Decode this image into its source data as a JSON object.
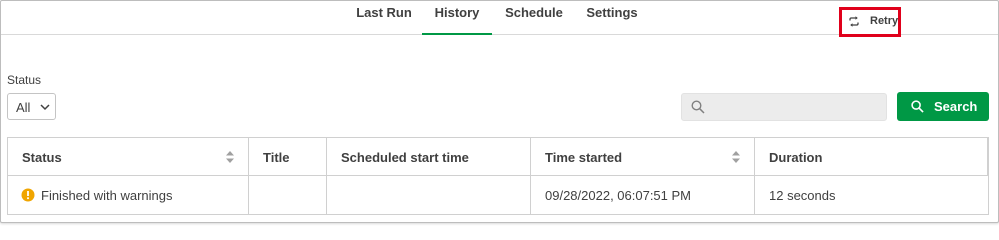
{
  "tabs": [
    {
      "label": "Last Run",
      "active": false
    },
    {
      "label": "History",
      "active": true
    },
    {
      "label": "Schedule",
      "active": false
    },
    {
      "label": "Settings",
      "active": false
    }
  ],
  "filter": {
    "status_label": "Status",
    "status_value": "All"
  },
  "search": {
    "placeholder": "",
    "button_label": "Search"
  },
  "table": {
    "columns": [
      "Status",
      "Title",
      "Scheduled start time",
      "Time started",
      "Duration"
    ],
    "rows": [
      {
        "status": "Finished with warnings",
        "title": "",
        "scheduled_start": "",
        "time_started": "09/28/2022, 06:07:51 PM",
        "duration": "12 seconds",
        "action_label": "Retry"
      }
    ]
  },
  "colors": {
    "accent": "#009845",
    "warning": "#f0a500",
    "highlight": "#e0001b"
  }
}
